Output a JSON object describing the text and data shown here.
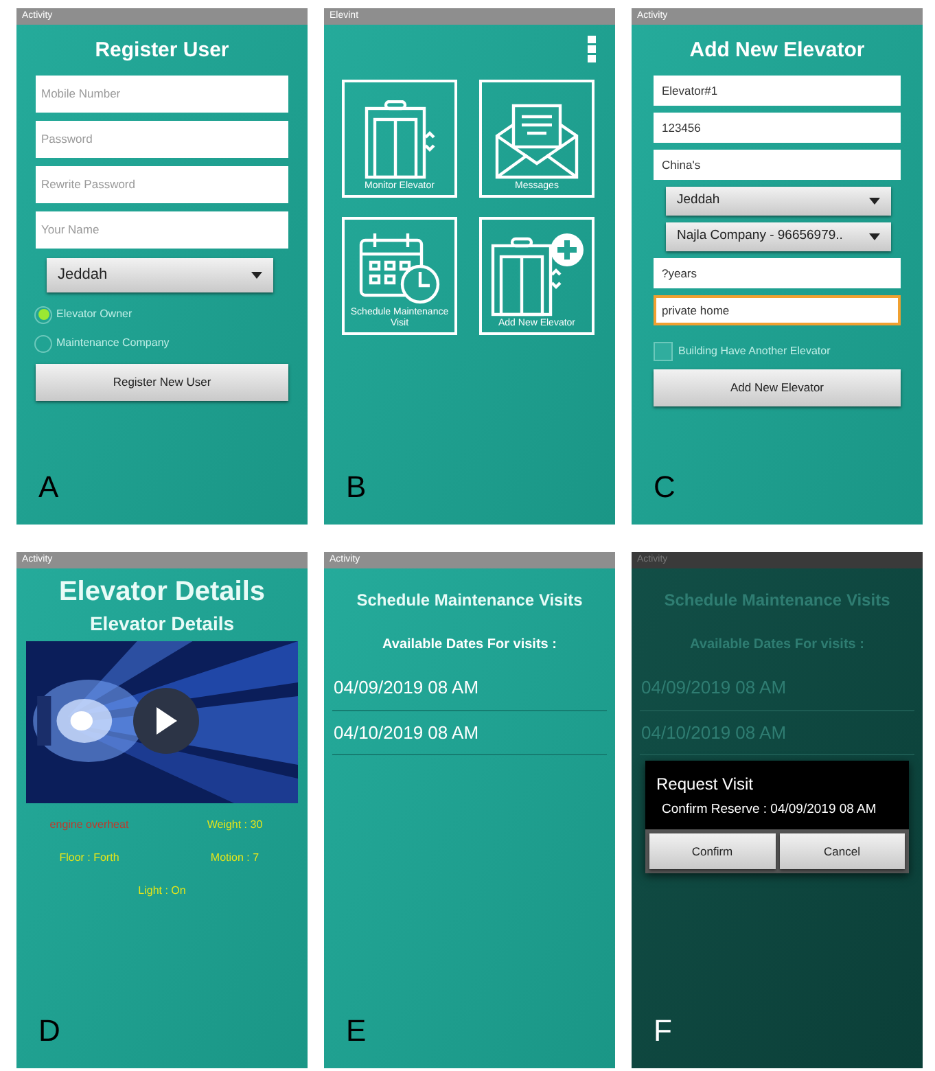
{
  "screens": [
    {
      "kind": "register",
      "status_bar": "Activity",
      "title": "Register User",
      "fields": [
        {
          "placeholder": "Mobile Number"
        },
        {
          "placeholder": "Password"
        },
        {
          "placeholder": "Rewrite Password"
        },
        {
          "placeholder": "Your Name"
        }
      ],
      "dropdown": "Jeddah",
      "radios": [
        {
          "label": "Elevator Owner",
          "selected": true
        },
        {
          "label": "Maintenance Company",
          "selected": false
        }
      ],
      "button": "Register New User",
      "panel_label": "A"
    },
    {
      "kind": "menu",
      "status_bar": "Elevint",
      "tiles": [
        {
          "label": "Monitor Elevator"
        },
        {
          "label": "Messages"
        },
        {
          "label": "Schedule Maintenance Visit"
        },
        {
          "label": "Add New Elevator"
        }
      ],
      "panel_label": "B"
    },
    {
      "kind": "add_elevator",
      "status_bar": "Activity",
      "title": "Add New Elevator",
      "form": [
        {
          "kind": "field",
          "value": "Elevator#1",
          "focused": false
        },
        {
          "kind": "field",
          "value": "123456",
          "focused": false
        },
        {
          "kind": "field",
          "value": "China's",
          "focused": false
        },
        {
          "kind": "dropdown",
          "value": "Jeddah"
        },
        {
          "kind": "dropdown",
          "value": "Najla Company - 96656979.."
        },
        {
          "kind": "field",
          "value": "?years",
          "focused": false
        },
        {
          "kind": "field",
          "value": "private home",
          "focused": true
        }
      ],
      "checkbox": {
        "label": "Building Have Another Elevator",
        "checked": false
      },
      "button": "Add New Elevator",
      "panel_label": "C"
    },
    {
      "kind": "details",
      "status_bar": "Activity",
      "title": "Elevator Details",
      "subtitle": "Elevator Details",
      "readings": [
        {
          "text": "engine overheat",
          "color": "#c0392b"
        },
        {
          "text": "Weight : 30",
          "color": "#e6e619"
        },
        {
          "text": "Floor : Forth",
          "color": "#e6e619"
        },
        {
          "text": "Motion : 7",
          "color": "#e6e619"
        },
        {
          "text": "Light : On",
          "color": "#e6e619"
        }
      ],
      "panel_label": "D"
    },
    {
      "kind": "schedule",
      "status_bar": "Activity",
      "title": "Schedule Maintenance Visits",
      "subtitle": "Available Dates For visits :",
      "dates": [
        "04/09/2019 08 AM",
        "04/10/2019 08 AM"
      ],
      "dimmed": false,
      "panel_label": "E"
    },
    {
      "kind": "schedule",
      "status_bar": "Activity",
      "title": "Schedule Maintenance Visits",
      "subtitle": "Available Dates For visits :",
      "dates": [
        "04/09/2019 08 AM",
        "04/10/2019 08 AM"
      ],
      "dimmed": true,
      "dialog": {
        "title": "Request Visit",
        "message": "Confirm Reserve : 04/09/2019 08 AM",
        "buttons": [
          "Confirm",
          "Cancel"
        ]
      },
      "panel_label": "F"
    }
  ]
}
